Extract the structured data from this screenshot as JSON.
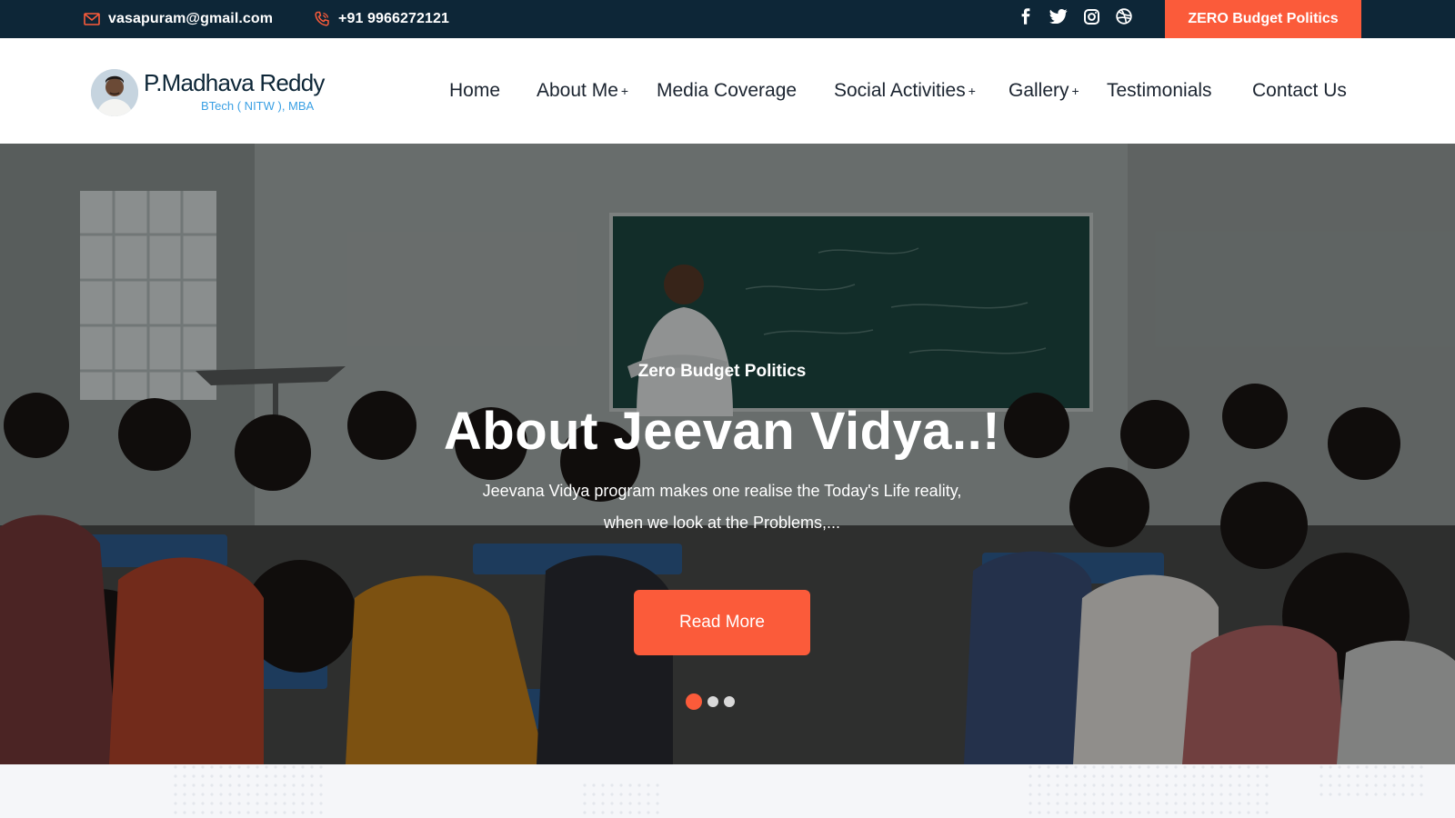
{
  "topbar": {
    "email": "vasapuram@gmail.com",
    "phone": "+91 9966272121",
    "socials": [
      "facebook-icon",
      "twitter-icon",
      "instagram-icon",
      "dribbble-icon"
    ],
    "cta_label": "ZERO Budget Politics"
  },
  "brand": {
    "name": "P.Madhava Reddy",
    "subtitle": "BTech ( NITW ), MBA"
  },
  "nav": {
    "items": [
      {
        "label": "Home",
        "has_submenu": false
      },
      {
        "label": "About Me",
        "has_submenu": true
      },
      {
        "label": "Media Coverage",
        "has_submenu": false
      },
      {
        "label": "Social Activities",
        "has_submenu": true
      },
      {
        "label": "Gallery",
        "has_submenu": true
      },
      {
        "label": "Testimonials",
        "has_submenu": false
      },
      {
        "label": "Contact Us",
        "has_submenu": false
      }
    ],
    "submenu_marker": "+"
  },
  "hero": {
    "tagline": "Zero Budget Politics",
    "title": "About Jeevan Vidya..!",
    "description": "Jeevana Vidya program makes one realise the Today's Life reality, when we look at the Problems,...",
    "button_label": "Read More",
    "slides_total": 3,
    "active_slide": 1
  },
  "colors": {
    "topbar_bg": "#0d2637",
    "accent": "#fb5b3a",
    "brand_sub": "#3aa0e4",
    "nav_text": "#1b2430"
  }
}
